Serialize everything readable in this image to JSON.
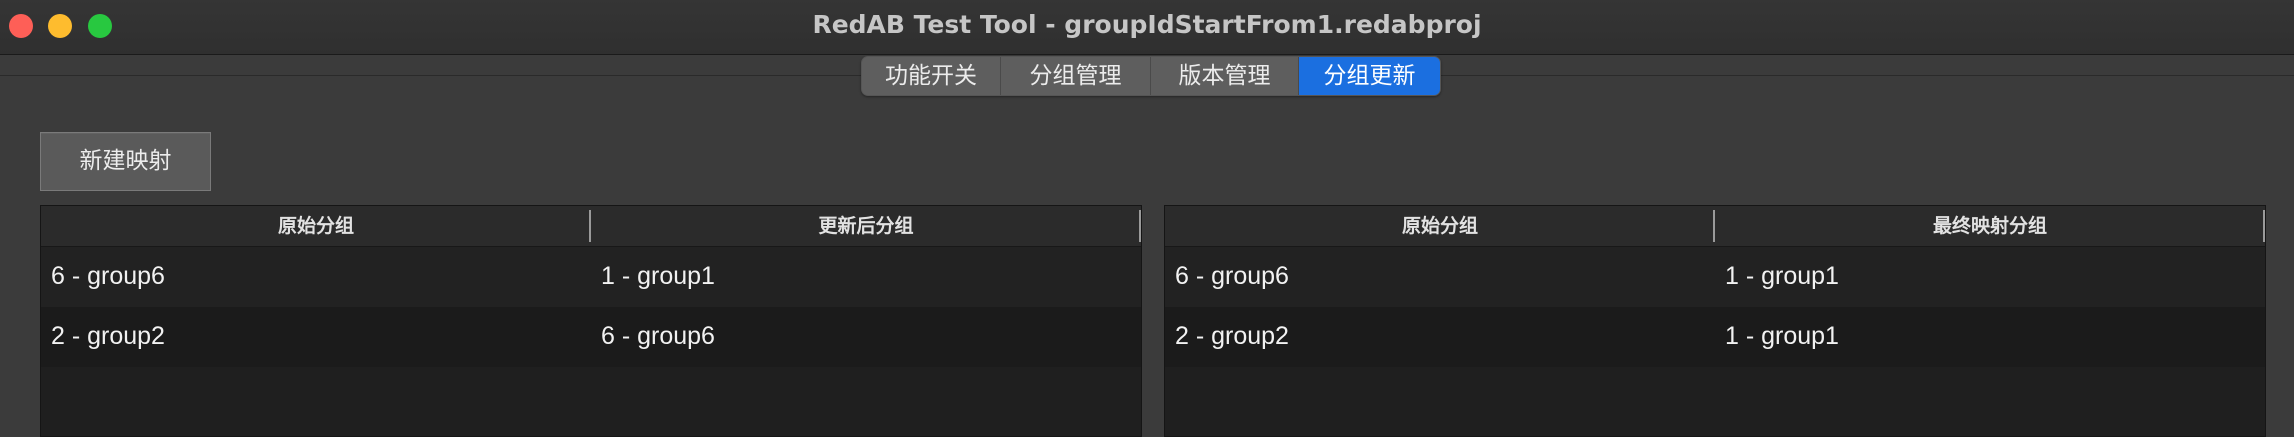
{
  "window": {
    "title": "RedAB Test Tool - groupIdStartFrom1.redabproj"
  },
  "tabs": [
    {
      "label": "功能开关",
      "selected": false
    },
    {
      "label": "分组管理",
      "selected": false
    },
    {
      "label": "版本管理",
      "selected": false
    },
    {
      "label": "分组更新",
      "selected": true
    }
  ],
  "toolbar": {
    "new_mapping_label": "新建映射"
  },
  "update_table": {
    "columns": [
      "原始分组",
      "更新后分组"
    ],
    "rows": [
      [
        "6 - group6",
        "1 - group1"
      ],
      [
        "2 - group2",
        "6 - group6"
      ]
    ]
  },
  "final_table": {
    "columns": [
      "原始分组",
      "最终映射分组"
    ],
    "rows": [
      [
        "6 - group6",
        "1 - group1"
      ],
      [
        "2 - group2",
        "1 - group1"
      ]
    ]
  },
  "colors": {
    "accent": "#1b6fe0",
    "close": "#fe5f57",
    "minimize": "#febc2e",
    "zoom": "#28c840"
  }
}
